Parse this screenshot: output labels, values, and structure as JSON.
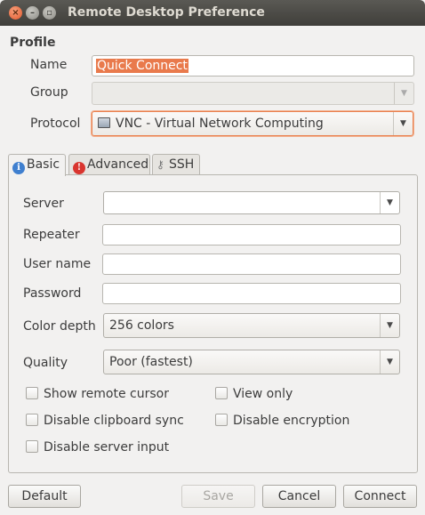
{
  "window": {
    "title": "Remote Desktop Preference",
    "close_glyph": "×",
    "min_glyph": "–",
    "max_glyph": "▫"
  },
  "profile": {
    "section_title": "Profile",
    "name_label": "Name",
    "name_value": "Quick Connect",
    "group_label": "Group",
    "group_value": "",
    "protocol_label": "Protocol",
    "protocol_value": "VNC - Virtual Network Computing"
  },
  "tabs": [
    {
      "label": "Basic",
      "icon": "info-icon",
      "active": true
    },
    {
      "label": "Advanced",
      "icon": "warning-icon",
      "active": false
    },
    {
      "label": "SSH",
      "icon": "ssh-key-icon",
      "active": false
    }
  ],
  "basic": {
    "server_label": "Server",
    "server_value": "",
    "repeater_label": "Repeater",
    "repeater_value": "",
    "username_label": "User name",
    "username_value": "",
    "password_label": "Password",
    "password_value": "",
    "color_depth_label": "Color depth",
    "color_depth_value": "256 colors",
    "quality_label": "Quality",
    "quality_value": "Poor (fastest)",
    "checkboxes": [
      {
        "label": "Show remote cursor",
        "checked": false
      },
      {
        "label": "View only",
        "checked": false
      },
      {
        "label": "Disable clipboard sync",
        "checked": false
      },
      {
        "label": "Disable encryption",
        "checked": false
      },
      {
        "label": "Disable server input",
        "checked": false
      }
    ]
  },
  "buttons": {
    "default": "Default",
    "save": "Save",
    "cancel": "Cancel",
    "connect": "Connect"
  },
  "colors": {
    "selection": "#e97a4c",
    "focus_border": "#e9814f",
    "titlebar": "#4a4945"
  }
}
